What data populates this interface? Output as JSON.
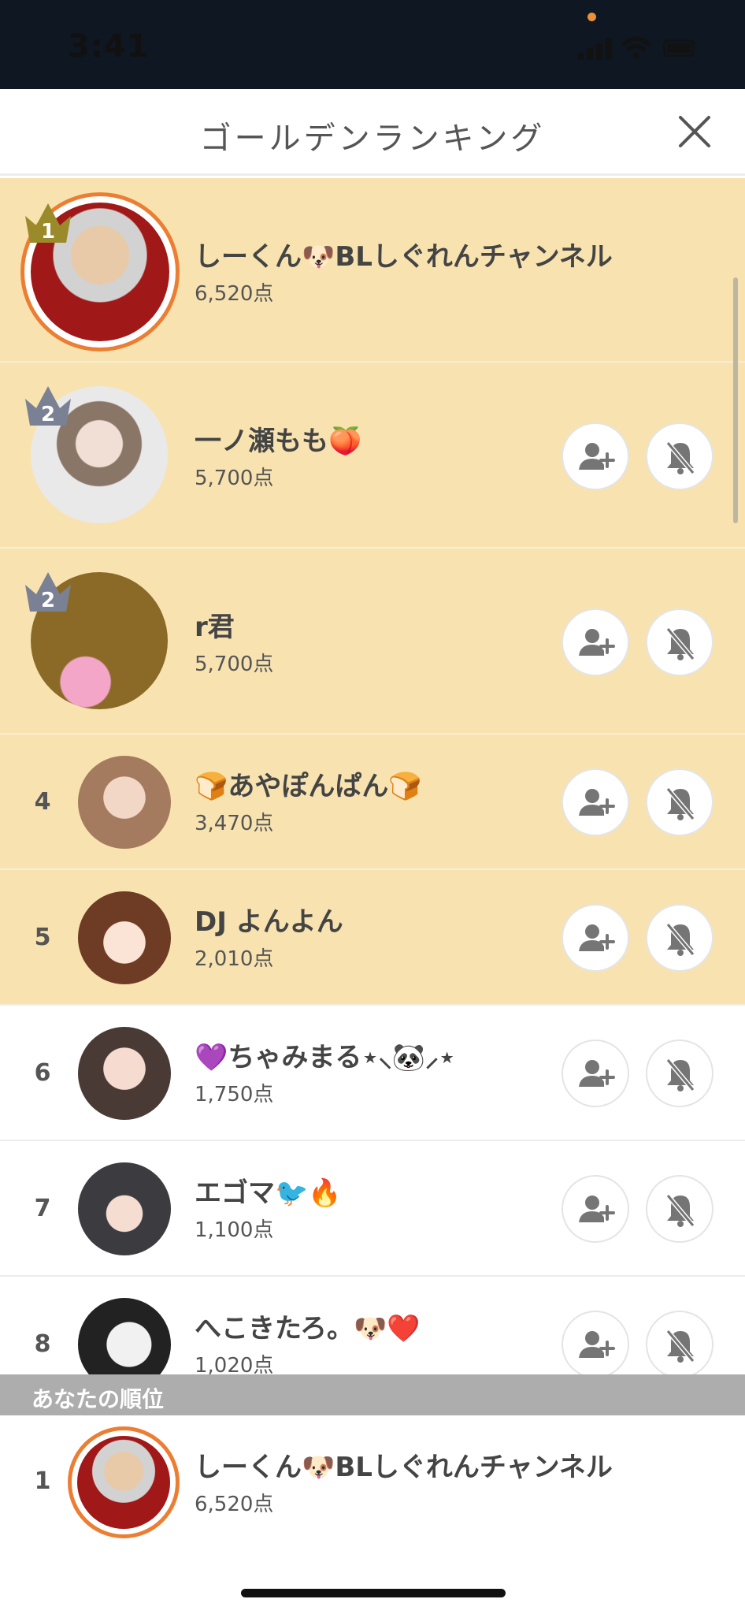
{
  "status_bar": {
    "time": "3:41"
  },
  "header": {
    "title": "ゴールデンランキング",
    "close_icon": "close-icon"
  },
  "icons": {
    "follow": "add-user-icon",
    "mute": "notification-off-icon",
    "crown": "crown-icon"
  },
  "colors": {
    "highlight_bg": "#f8e3b0",
    "accent_ring": "#ec7e33",
    "crown_gold": "#9a8a2a",
    "crown_silver": "#7b8194"
  },
  "rankings": [
    {
      "rank": "1",
      "name": "しーくん🐶BLしぐれんチャンネル",
      "score": "6,520点"
    },
    {
      "rank": "2",
      "name": "一ノ瀬もも🍑",
      "score": "5,700点"
    },
    {
      "rank": "2",
      "name": "r君",
      "score": "5,700点"
    },
    {
      "rank": "4",
      "name": "🍞あやぽんぱん🍞",
      "score": "3,470点"
    },
    {
      "rank": "5",
      "name": "DJ よんよん",
      "score": "2,010点"
    },
    {
      "rank": "6",
      "name": "💜ちゃみまる⋆⸜🐼⸝⋆",
      "score": "1,750点"
    },
    {
      "rank": "7",
      "name": "エゴマ🐦🔥",
      "score": "1,100点"
    },
    {
      "rank": "8",
      "name": "へこきたろ。🐶❤️",
      "score": "1,020点"
    }
  ],
  "your_rank": {
    "label": "あなたの順位",
    "rank": "1",
    "name": "しーくん🐶BLしぐれんチャンネル",
    "score": "6,520点"
  }
}
